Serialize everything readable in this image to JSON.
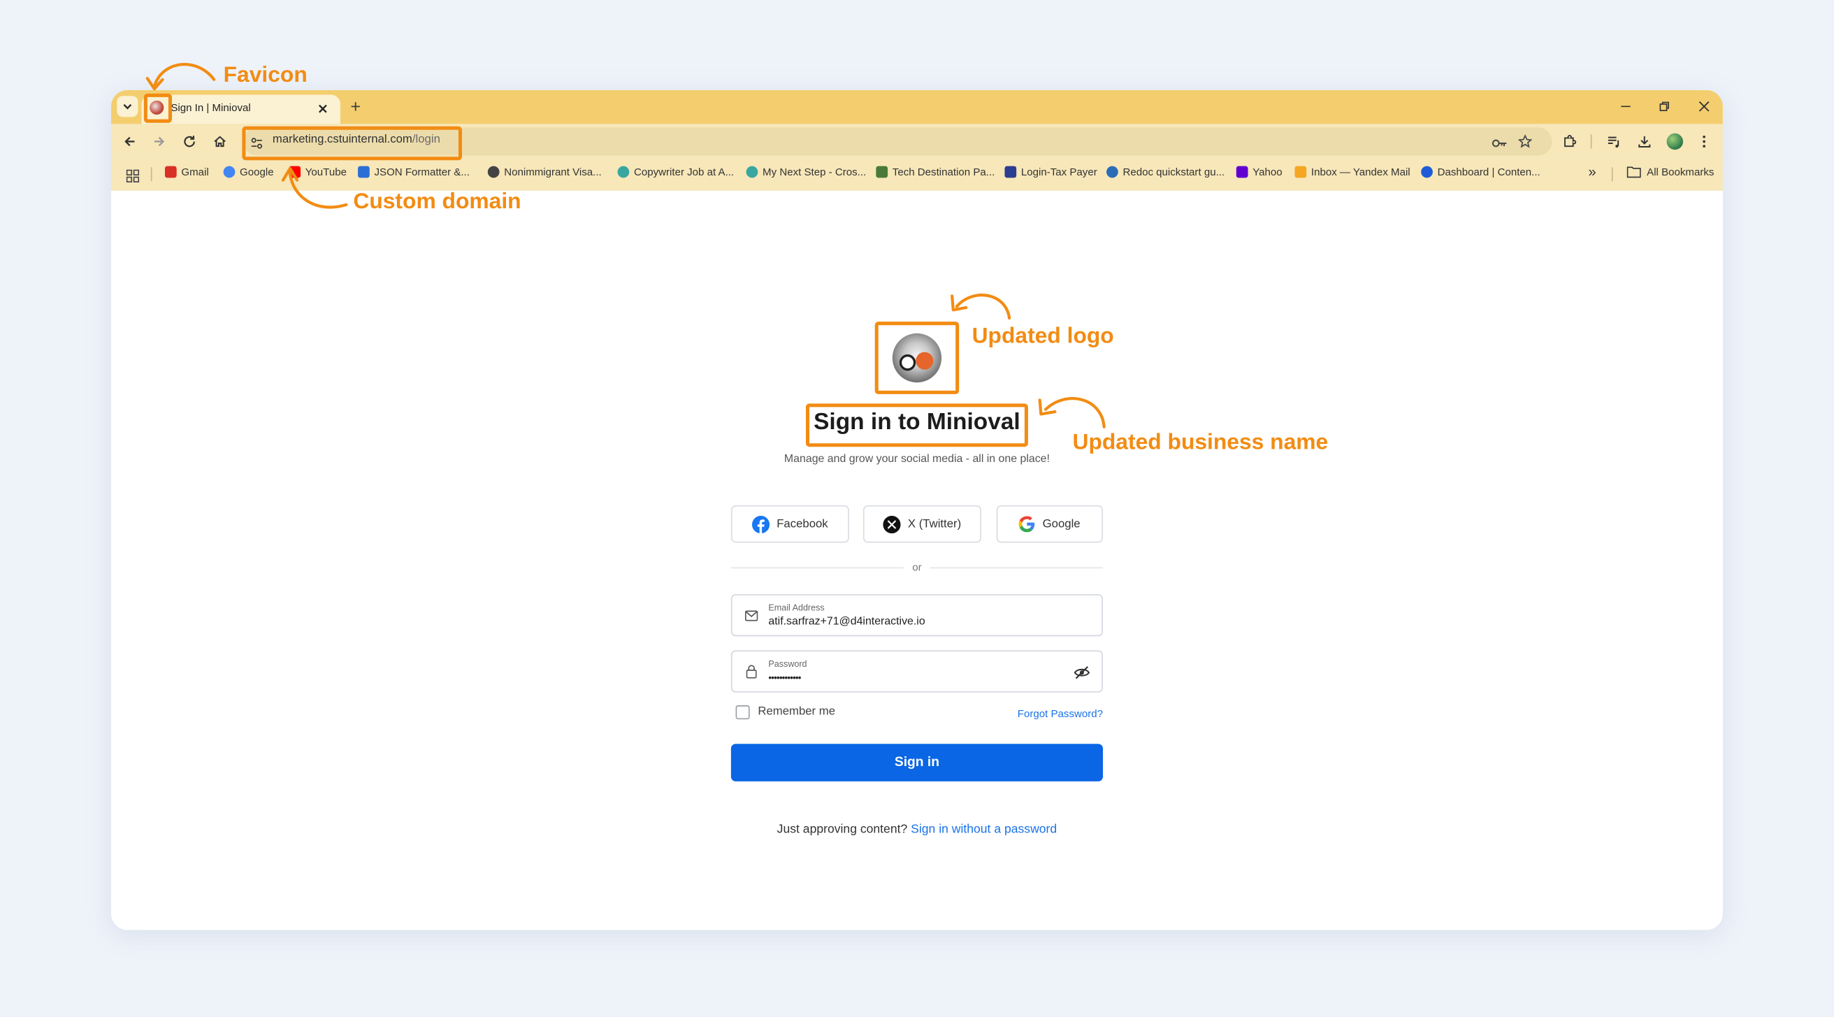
{
  "browser": {
    "tab_title": "Sign In | Minioval",
    "new_tab_symbol": "+",
    "url_domain": "marketing.cstuinternal.com",
    "url_path": "/login",
    "window_controls": [
      "minimize-icon",
      "restore-icon",
      "close-icon"
    ],
    "bookmarks": [
      {
        "label": "Gmail",
        "color": "#d93025"
      },
      {
        "label": "Google",
        "color": "#4285f4"
      },
      {
        "label": "YouTube",
        "color": "#ff0000"
      },
      {
        "label": "JSON Formatter &...",
        "color": "#2b6fd6"
      },
      {
        "label": "Nonimmigrant Visa...",
        "color": "#444444"
      },
      {
        "label": "Copywriter Job at A...",
        "color": "#3aa6a0"
      },
      {
        "label": "My Next Step - Cros...",
        "color": "#3aa6a0"
      },
      {
        "label": "Tech Destination Pa...",
        "color": "#4a7a3a"
      },
      {
        "label": "Login-Tax Payer",
        "color": "#2c3e90"
      },
      {
        "label": "Redoc quickstart gu...",
        "color": "#2a6db5"
      },
      {
        "label": "Yahoo",
        "color": "#6001d2"
      },
      {
        "label": "Inbox — Yandex Mail",
        "color": "#f5a623"
      },
      {
        "label": "Dashboard | Conten...",
        "color": "#1f5bd8"
      }
    ],
    "bookmarks_overflow": "»",
    "all_bookmarks": "All Bookmarks"
  },
  "annotations": {
    "favicon": "Favicon",
    "custom_domain": "Custom domain",
    "updated_logo": "Updated logo",
    "updated_business_name": "Updated business name"
  },
  "login": {
    "title": "Sign in to Minioval",
    "subtitle": "Manage and grow your social media - all in one place!",
    "social_buttons": [
      {
        "label": "Facebook",
        "icon": "facebook-icon"
      },
      {
        "label": "X (Twitter)",
        "icon": "x-twitter-icon"
      },
      {
        "label": "Google",
        "icon": "google-icon"
      }
    ],
    "divider": "or",
    "email_label": "Email Address",
    "email_value": "atif.sarfraz+71@d4interactive.io",
    "password_label": "Password",
    "password_value": "••••••••••••",
    "remember_me": "Remember me",
    "forgot_password": "Forgot Password?",
    "sign_in": "Sign in",
    "approving_text": "Just approving content?",
    "passwordless_link": "Sign in without a password"
  },
  "colors": {
    "accent": "#f28c13",
    "primary_button": "#0a66e4",
    "link": "#1a73e8",
    "tabstrip": "#f4ce6e",
    "toolbar": "#f7e7b9"
  }
}
